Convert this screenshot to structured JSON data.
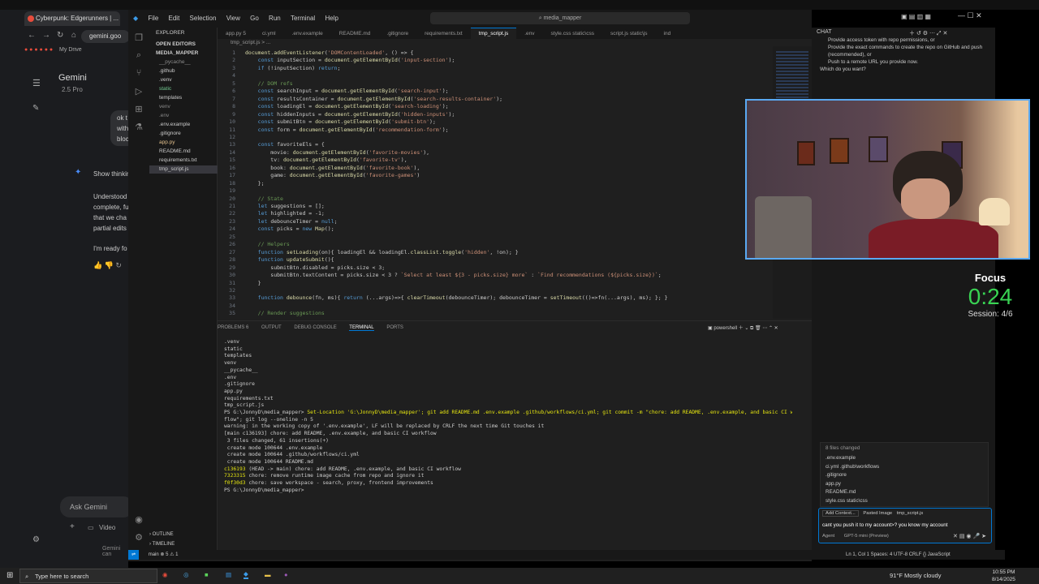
{
  "browser": {
    "tab_title": "Cyberpunk: Edgerunners | ...",
    "address": "gemini.goo",
    "bookmark": "My Drive",
    "gemini_title": "Gemini",
    "model": "2.5 Pro",
    "user_msg": [
      "ok t",
      "with",
      "bloc"
    ],
    "show_thinking": "Show thinkin",
    "reply": [
      "Understood",
      "complete, fu",
      "that we cha",
      "partial edits"
    ],
    "reply2": "I'm ready fo",
    "ask": "Ask Gemini",
    "video": "Video",
    "footer": "Gemini can"
  },
  "vscode": {
    "menu": [
      "File",
      "Edit",
      "Selection",
      "View",
      "Go",
      "Run",
      "Terminal",
      "Help"
    ],
    "search": "media_mapper",
    "explorer": "EXPLORER",
    "open_editors": "OPEN EDITORS",
    "project": "MEDIA_MAPPER",
    "files": [
      {
        "name": "__pycache__",
        "color": "#8b8b8b"
      },
      {
        "name": ".github",
        "color": "#ccc"
      },
      {
        "name": ".venv",
        "color": "#ccc"
      },
      {
        "name": "static",
        "color": "#73c991"
      },
      {
        "name": "templates",
        "color": "#ccc"
      },
      {
        "name": "venv",
        "color": "#8b8b8b"
      },
      {
        "name": ".env",
        "color": "#8b8b8b"
      },
      {
        "name": ".env.example",
        "color": "#ccc"
      },
      {
        "name": ".gitignore",
        "color": "#ccc"
      },
      {
        "name": "app.py",
        "color": "#e2c08d"
      },
      {
        "name": "README.md",
        "color": "#ccc"
      },
      {
        "name": "requirements.txt",
        "color": "#ccc"
      },
      {
        "name": "tmp_script.js",
        "color": "#ccc"
      }
    ],
    "tabs": [
      "app.py 5",
      "ci.yml",
      ".env.example",
      "README.md",
      ".gitignore",
      "requirements.txt",
      "tmp_script.js",
      ".env",
      "style.css static\\css",
      "script.js static\\js",
      "ind"
    ],
    "active_tab_index": 6,
    "breadcrumb": "tmp_script.js > ...",
    "code": [
      "document.addEventListener('DOMContentLoaded', () => {",
      "    const inputSection = document.getElementById('input-section');",
      "    if (!inputSection) return;",
      "",
      "    // DOM refs",
      "    const searchInput = document.getElementById('search-input');",
      "    const resultsContainer = document.getElementById('search-results-container');",
      "    const loadingEl = document.getElementById('search-loading');",
      "    const hiddenInputs = document.getElementById('hidden-inputs');",
      "    const submitBtn = document.getElementById('submit-btn');",
      "    const form = document.getElementById('recommendation-form');",
      "",
      "    const favoriteEls = {",
      "        movie: document.getElementById('favorite-movies'),",
      "        tv: document.getElementById('favorite-tv'),",
      "        book: document.getElementById('favorite-book'),",
      "        game: document.getElementById('favorite-games')",
      "    };",
      "",
      "    // State",
      "    let suggestions = [];",
      "    let highlighted = -1;",
      "    let debounceTimer = null;",
      "    const picks = new Map();",
      "",
      "    // Helpers",
      "    function setLoading(on){ loadingEl && loadingEl.classList.toggle('hidden', !on); }",
      "    function updateSubmit(){",
      "        submitBtn.disabled = picks.size < 3;",
      "        submitBtn.textContent = picks.size < 3 ? `Select at least ${3 - picks.size} more` : `Find recommendations (${picks.size})`;",
      "    }",
      "",
      "    function debounce(fn, ms){ return (...args)=>{ clearTimeout(debounceTimer); debounceTimer = setTimeout(()=>fn(...args), ms); }; }",
      "",
      "    // Render suggestions"
    ],
    "panel_tabs": [
      "PROBLEMS 6",
      "OUTPUT",
      "DEBUG CONSOLE",
      "TERMINAL",
      "PORTS"
    ],
    "shell": "powershell",
    "terminal": [
      ".venv",
      "static",
      "templates",
      "venv",
      "__pycache__",
      ".env",
      ".gitignore",
      "app.py",
      "requirements.txt",
      "tmp_script.js",
      "",
      "PS G:\\JonnyD\\media_mapper> Set-Location 'G:\\JonnyD\\media_mapper'; git add README.md .env.example .github/workflows/ci.yml; git commit -m \"chore: add README, .env.example, and basic CI work",
      "flow\"; git log --oneline -n 5",
      "warning: in the working copy of '.env.example', LF will be replaced by CRLF the next time Git touches it",
      "[main c136193] chore: add README, .env.example, and basic CI workflow",
      " 3 files changed, 61 insertions(+)",
      " create mode 100644 .env.example",
      " create mode 100644 .github/workflows/ci.yml",
      " create mode 100644 README.md",
      "c136193 (HEAD -> main) chore: add README, .env.example, and basic CI workflow",
      "7323315 chore: remove runtime image cache from repo and ignore it",
      "f0f30d3 chore: save workspace - search, proxy, frontend improvements",
      "PS G:\\JonnyD\\media_mapper> "
    ],
    "outline": "OUTLINE",
    "timeline": "TIMELINE",
    "status_left": "main   ⊗ 5 ⚠ 1",
    "status_right": "Ln 1, Col 1    Spaces: 4    UTF-8    CRLF    {} JavaScript"
  },
  "chat": {
    "title": "CHAT",
    "lines": [
      "Provide access token with repo permissions, or",
      "Provide the exact commands to create the repo on GitHub and push",
      "(recommended), or",
      "Push to a remote URL you provide now.",
      "",
      "Which do you want?"
    ],
    "changed_title": "8 files changed",
    "changed_files": [
      ".env.example",
      "ci.yml .github\\workflows",
      ".gitignore",
      "app.py",
      "README.md",
      "style.css static\\css"
    ],
    "context": [
      "Add Context...",
      "Pasted Image",
      "tmp_script.js"
    ],
    "input_text": "cant you push it to my account>? you know my account",
    "agent": "Agent",
    "model": "GPT-5 mini (Preview)"
  },
  "focus": {
    "label": "Focus",
    "timer": "0:24",
    "session": "Session: 4/6"
  },
  "taskbar": {
    "search": "Type here to search",
    "weather": "91°F  Mostly cloudy",
    "time": "10:55 PM",
    "date": "8/14/2025"
  }
}
